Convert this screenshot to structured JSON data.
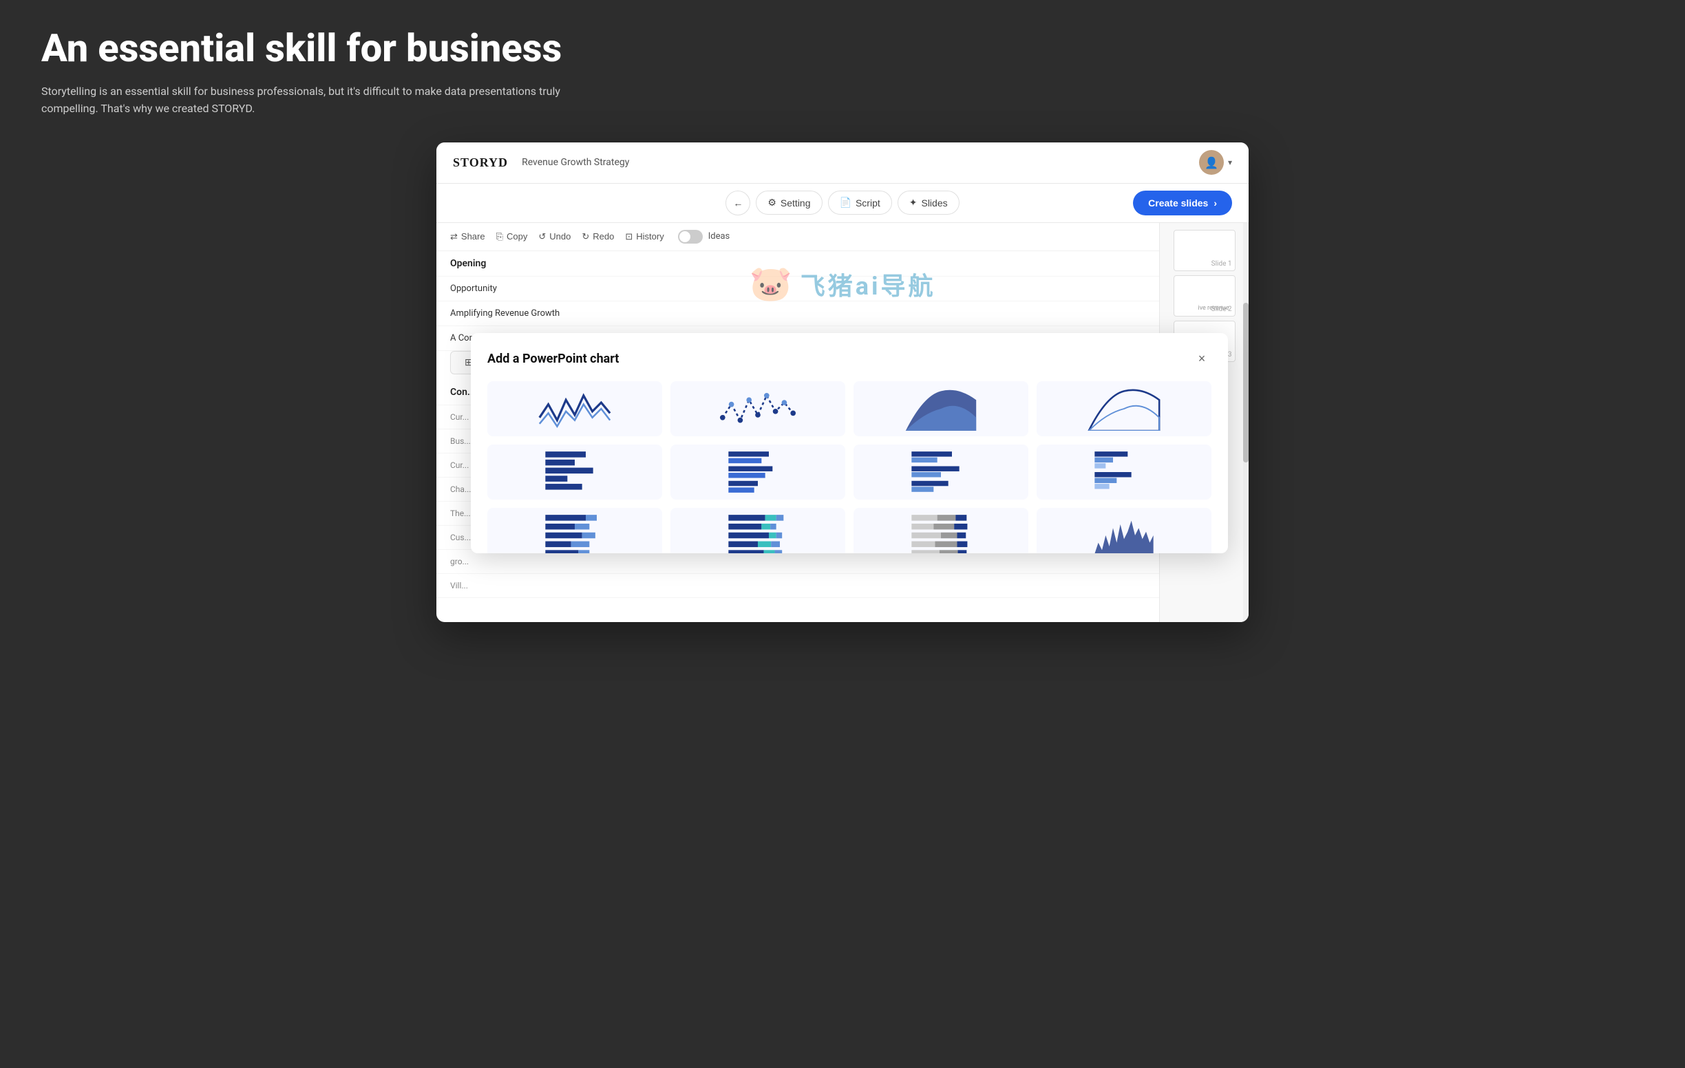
{
  "page": {
    "title": "An essential skill for business",
    "subtitle": "Storytelling is an essential skill for business professionals, but it's difficult to make data presentations truly compelling. That's why we created STORYD."
  },
  "app": {
    "logo": "STORYD",
    "doc_title": "Revenue Growth Strategy",
    "toolbar": {
      "back_label": "←",
      "setting_label": "Setting",
      "script_label": "Script",
      "slides_label": "Slides",
      "create_label": "Create slides",
      "create_icon": "›"
    },
    "action_bar": {
      "share": "Share",
      "copy": "Copy",
      "undo": "Undo",
      "redo": "Redo",
      "history": "History",
      "ideas": "Ideas"
    },
    "script": {
      "items": [
        {
          "type": "section",
          "text": "Opening"
        },
        {
          "type": "item",
          "text": "Opportunity"
        },
        {
          "type": "item",
          "text": "Amplifying Revenue Growth"
        },
        {
          "type": "item",
          "text": "A Comprehensive Strategy for Increasing Revenue"
        },
        {
          "type": "add_chart",
          "text": "Add a PowerPoint chart"
        },
        {
          "type": "section",
          "text": "Con..."
        },
        {
          "type": "item",
          "text": "Cur..."
        },
        {
          "type": "item",
          "text": "Bus..."
        },
        {
          "type": "item",
          "text": "Cur..."
        },
        {
          "type": "item",
          "text": "Cha..."
        },
        {
          "type": "item",
          "text": "The..."
        },
        {
          "type": "item",
          "text": "Cus..."
        },
        {
          "type": "item",
          "text": "gro..."
        },
        {
          "type": "item",
          "text": "Vill..."
        }
      ]
    },
    "slides": [
      {
        "label": "Slide 1"
      },
      {
        "label": "Slide 2"
      },
      {
        "label": "Slide 3"
      }
    ],
    "modal": {
      "title": "Add a PowerPoint chart",
      "close_label": "×",
      "charts": [
        {
          "type": "line-wavy",
          "row": 0
        },
        {
          "type": "scatter-wavy",
          "row": 0
        },
        {
          "type": "area-blue",
          "row": 0
        },
        {
          "type": "area-outline",
          "row": 0
        },
        {
          "type": "bar-h-multi1",
          "row": 1
        },
        {
          "type": "bar-h-multi2",
          "row": 1
        },
        {
          "type": "bar-h-multi3",
          "row": 1
        },
        {
          "type": "bar-h-multi4",
          "row": 1
        },
        {
          "type": "bar-stacked1",
          "row": 2
        },
        {
          "type": "bar-stacked2",
          "row": 2
        },
        {
          "type": "bar-stacked3",
          "row": 2
        },
        {
          "type": "area-spiky",
          "row": 2
        }
      ]
    },
    "sidebar_scroll": {
      "right_revenue": "ive revenue"
    }
  }
}
